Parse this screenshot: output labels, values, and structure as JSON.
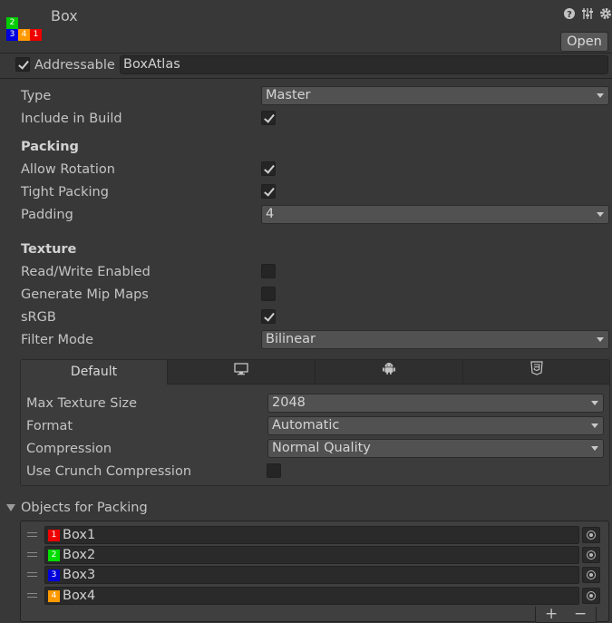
{
  "header": {
    "title": "Box",
    "open_label": "Open",
    "thumb": [
      {
        "label": "2",
        "color": "#00cc00"
      },
      {
        "label": "3",
        "color": "#0000dd"
      },
      {
        "label": "4",
        "color": "#ff9900"
      },
      {
        "label": "1",
        "color": "#ee0000"
      }
    ],
    "icons": [
      "help-icon",
      "preset-icon",
      "gear-icon"
    ]
  },
  "addressable": {
    "label": "Addressable",
    "checked": true,
    "value": "BoxAtlas"
  },
  "general": {
    "type_label": "Type",
    "type_value": "Master",
    "include_label": "Include in Build",
    "include_checked": true
  },
  "packing": {
    "header": "Packing",
    "allow_rotation_label": "Allow Rotation",
    "allow_rotation": true,
    "tight_packing_label": "Tight Packing",
    "tight_packing": true,
    "padding_label": "Padding",
    "padding_value": "4"
  },
  "texture": {
    "header": "Texture",
    "rw_label": "Read/Write Enabled",
    "rw": false,
    "mip_label": "Generate Mip Maps",
    "mip": false,
    "srgb_label": "sRGB",
    "srgb": true,
    "filter_label": "Filter Mode",
    "filter_value": "Bilinear"
  },
  "platforms": {
    "tabs": [
      {
        "label": "Default",
        "icon": ""
      },
      {
        "label": "",
        "icon": "monitor-icon"
      },
      {
        "label": "",
        "icon": "android-icon"
      },
      {
        "label": "",
        "icon": "html5-icon"
      }
    ],
    "max_size_label": "Max Texture Size",
    "max_size_value": "2048",
    "format_label": "Format",
    "format_value": "Automatic",
    "compression_label": "Compression",
    "compression_value": "Normal Quality",
    "crunch_label": "Use Crunch Compression",
    "crunch": false
  },
  "objects": {
    "header": "Objects for Packing",
    "items": [
      {
        "name": "Box1",
        "badge": "1",
        "color": "#ee0000"
      },
      {
        "name": "Box2",
        "badge": "2",
        "color": "#00dd00"
      },
      {
        "name": "Box3",
        "badge": "3",
        "color": "#0000dd"
      },
      {
        "name": "Box4",
        "badge": "4",
        "color": "#ff9900"
      }
    ],
    "add_label": "+",
    "remove_label": "−"
  }
}
